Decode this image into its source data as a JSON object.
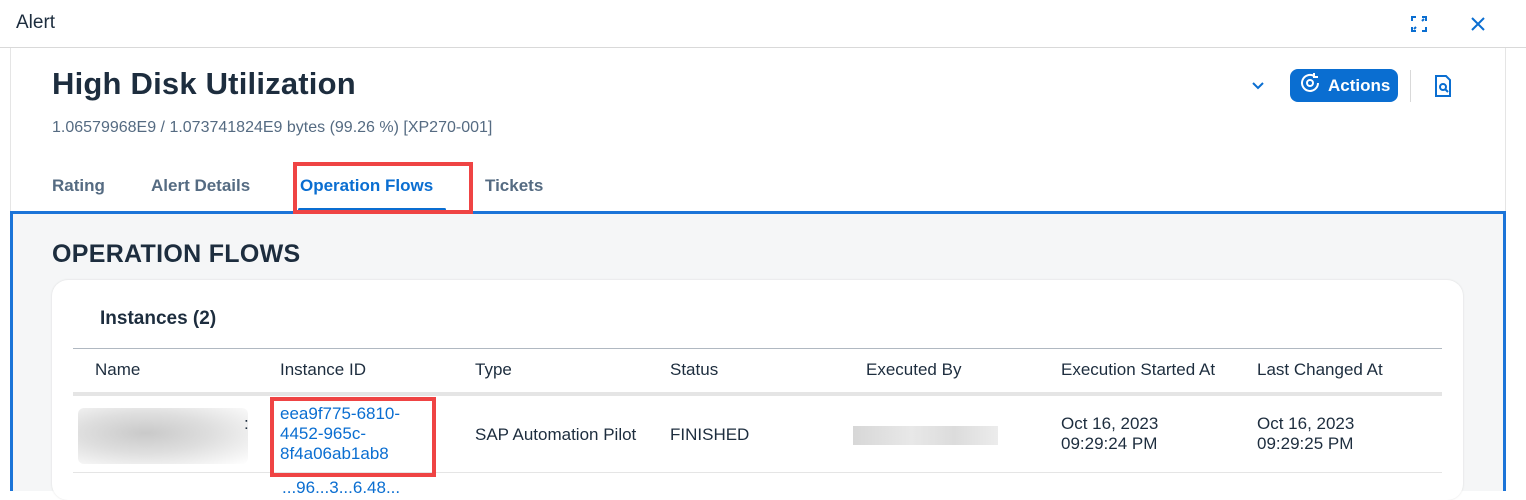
{
  "window": {
    "title": "Alert",
    "icons": {
      "expand": "expand-icon",
      "close": "close-icon"
    }
  },
  "header": {
    "title": "High Disk Utilization",
    "subtitle": "1.06579968E9 / 1.073741824E9 bytes (99.26 %) [XP270-001]",
    "actions_label": "Actions",
    "icons": {
      "chevron": "chevron-down-icon",
      "actions": "refresh-gear-icon",
      "document": "document-search-icon"
    }
  },
  "tabs": [
    {
      "label": "Rating",
      "active": false
    },
    {
      "label": "Alert Details",
      "active": false
    },
    {
      "label": "Operation Flows",
      "active": true
    },
    {
      "label": "Tickets",
      "active": false
    }
  ],
  "section": {
    "title": "OPERATION FLOWS",
    "table": {
      "title": "Instances (2)",
      "columns": [
        "Name",
        "Instance ID",
        "Type",
        "Status",
        "Executed By",
        "Execution Started At",
        "Last Changed At"
      ],
      "rows": [
        {
          "name": "",
          "name_suffix": ":",
          "instance_id_lines": [
            "eea9f775-6810-",
            "4452-965c-",
            "8f4a06ab1ab8"
          ],
          "type": "SAP Automation Pilot",
          "status": "FINISHED",
          "executed_by": "",
          "started_lines": [
            "Oct 16, 2023",
            "09:29:24 PM"
          ],
          "changed_lines": [
            "Oct 16, 2023",
            "09:29:25 PM"
          ]
        }
      ],
      "next_row_partial_id": "...96...3...6.48..."
    }
  },
  "colors": {
    "accent": "#0a6ed1",
    "highlight": "#ef4444",
    "text": "#1d2d3e",
    "muted": "#556b82"
  }
}
